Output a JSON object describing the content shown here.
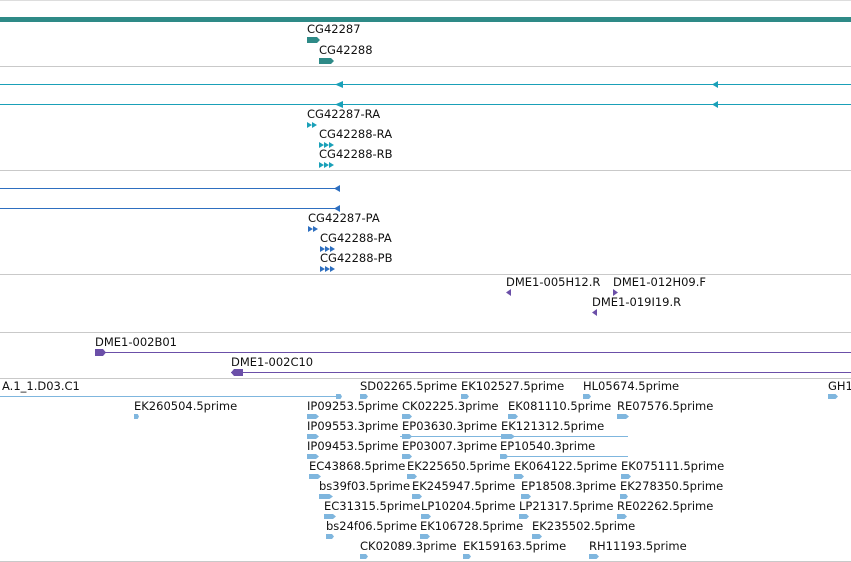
{
  "gene_track": {
    "labels": [
      "CG42287",
      "CG42288"
    ],
    "color": "#2e8a87"
  },
  "transcript_track": {
    "labels": [
      "CG42287-RA",
      "CG42288-RA",
      "CG42288-RB"
    ],
    "color": "#1aa0b8"
  },
  "protein_track": {
    "labels": [
      "CG42287-PA",
      "CG42288-PA",
      "CG42288-PB"
    ],
    "color": "#2e6fc0"
  },
  "clone_track": {
    "labels": [
      "DME1-005H12.R",
      "DME1-012H09.F",
      "DME1-019I19.R"
    ],
    "color": "#6b4fa8"
  },
  "bac_track": {
    "labels": [
      "DME1-002B01",
      "DME1-002C10"
    ],
    "color": "#6b4fa8"
  },
  "est_track": {
    "color": "#7fb6de",
    "labels": [
      "A.1_1.D03.C1",
      "SD02265.5prime",
      "EK102527.5prime",
      "HL05674.5prime",
      "GH1",
      "EK260504.5prime",
      "IP09253.5prime",
      "CK02225.3prime",
      "EK081110.5prime",
      "RE07576.5prime",
      "IP09553.3prime",
      "EP03630.3prime",
      "EK121312.5prime",
      "IP09453.5prime",
      "EP03007.3prime",
      "EP10540.3prime",
      "EC43868.5prime",
      "EK225650.5prime",
      "EK064122.5prime",
      "EK075111.5prime",
      "bs39f03.5prime",
      "EK245947.5prime",
      "EP18508.3prime",
      "EK278350.5prime",
      "EC31315.5prime",
      "LP10204.5prime",
      "LP21317.5prime",
      "RE02262.5prime",
      "bs24f06.5prime",
      "EK106728.5prime",
      "EK235502.5prime",
      "CK02089.3prime",
      "EK159163.5prime",
      "RH11193.5prime"
    ]
  }
}
